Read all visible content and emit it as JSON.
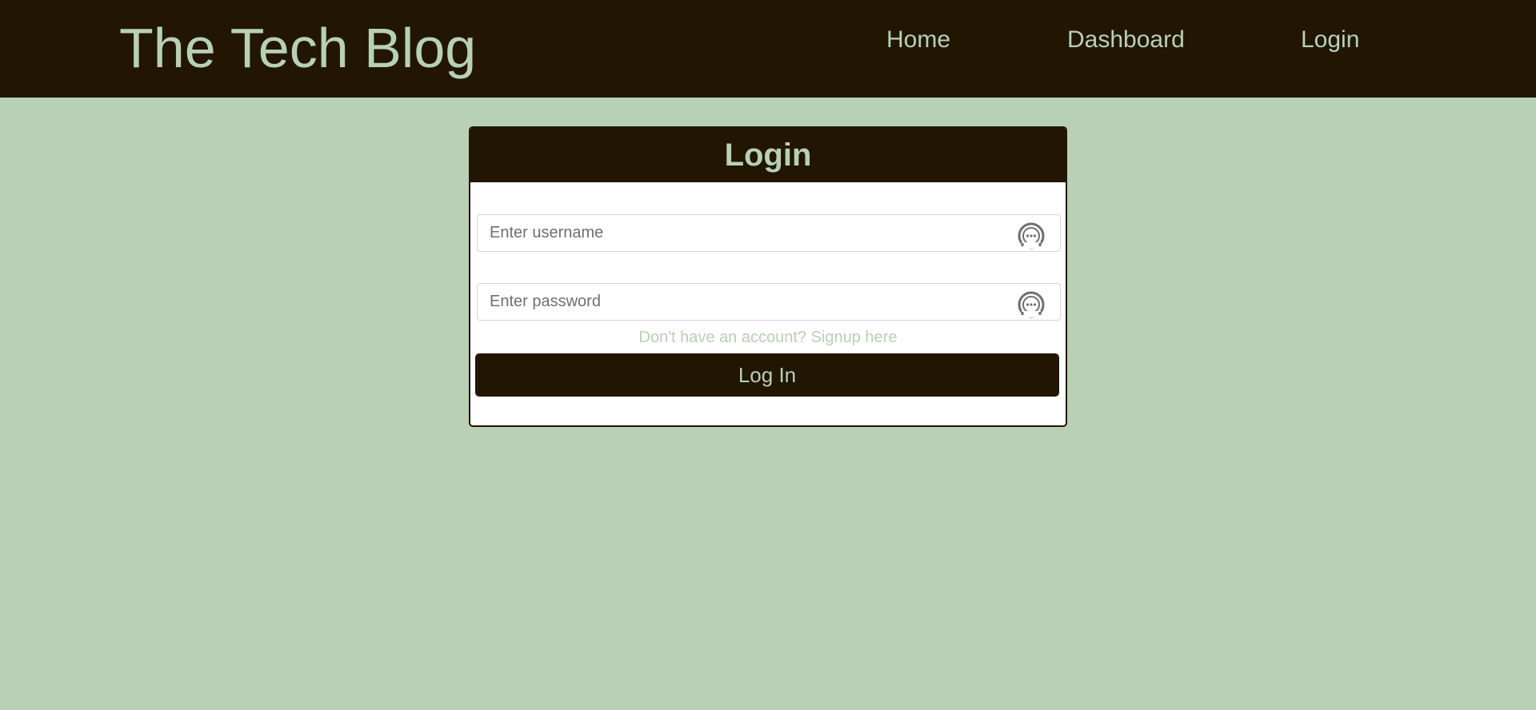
{
  "navbar": {
    "brand": "The Tech Blog",
    "links": [
      {
        "label": "Home"
      },
      {
        "label": "Dashboard"
      },
      {
        "label": "Login"
      }
    ]
  },
  "login_card": {
    "title": "Login",
    "username": {
      "value": "",
      "placeholder": "Enter username",
      "icon": "password-manager-icon"
    },
    "password": {
      "value": "",
      "placeholder": "Enter password",
      "icon": "password-manager-icon"
    },
    "signup_link": "Don't have an account? Signup here",
    "submit_label": "Log In"
  },
  "colors": {
    "background": "#b8d0b4",
    "dark": "#221603",
    "accent_text": "#b8d0b4",
    "card": "#ffffff"
  }
}
